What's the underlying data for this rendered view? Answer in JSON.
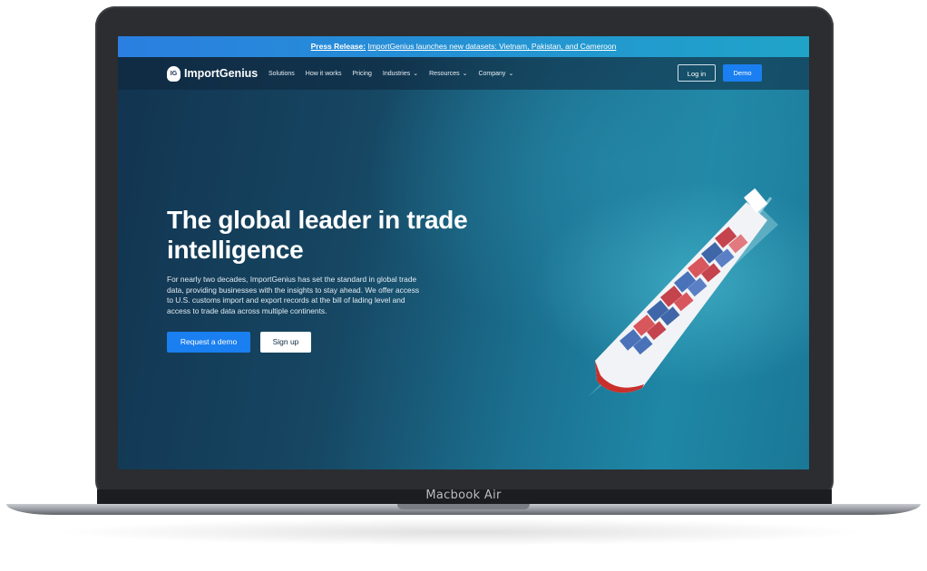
{
  "announcement": {
    "label": "Press Release:",
    "message": "ImportGenius launches new datasets: Vietnam, Pakistan, and Cameroon"
  },
  "brand": {
    "logo_mark": "IG",
    "name": "ImportGenius"
  },
  "nav": {
    "items": [
      {
        "label": "Solutions",
        "dropdown": false
      },
      {
        "label": "How it works",
        "dropdown": false
      },
      {
        "label": "Pricing",
        "dropdown": false
      },
      {
        "label": "Industries",
        "dropdown": true
      },
      {
        "label": "Resources",
        "dropdown": true
      },
      {
        "label": "Company",
        "dropdown": true
      }
    ],
    "login_label": "Log in",
    "demo_label": "Demo"
  },
  "hero": {
    "headline": "The global leader in trade intelligence",
    "body": "For nearly two decades, ImportGenius has set the standard in global trade data, providing businesses with the insights to stay ahead. We offer access to U.S. customs import and export records at the bill of lading level and access to trade data across multiple continents.",
    "primary_cta": "Request a demo",
    "secondary_cta": "Sign up"
  },
  "device": {
    "label": "Macbook Air"
  },
  "colors": {
    "accent": "#1a7ff0",
    "announcement_bar": "#2a7fe0",
    "sea": "#1b6f8f"
  }
}
